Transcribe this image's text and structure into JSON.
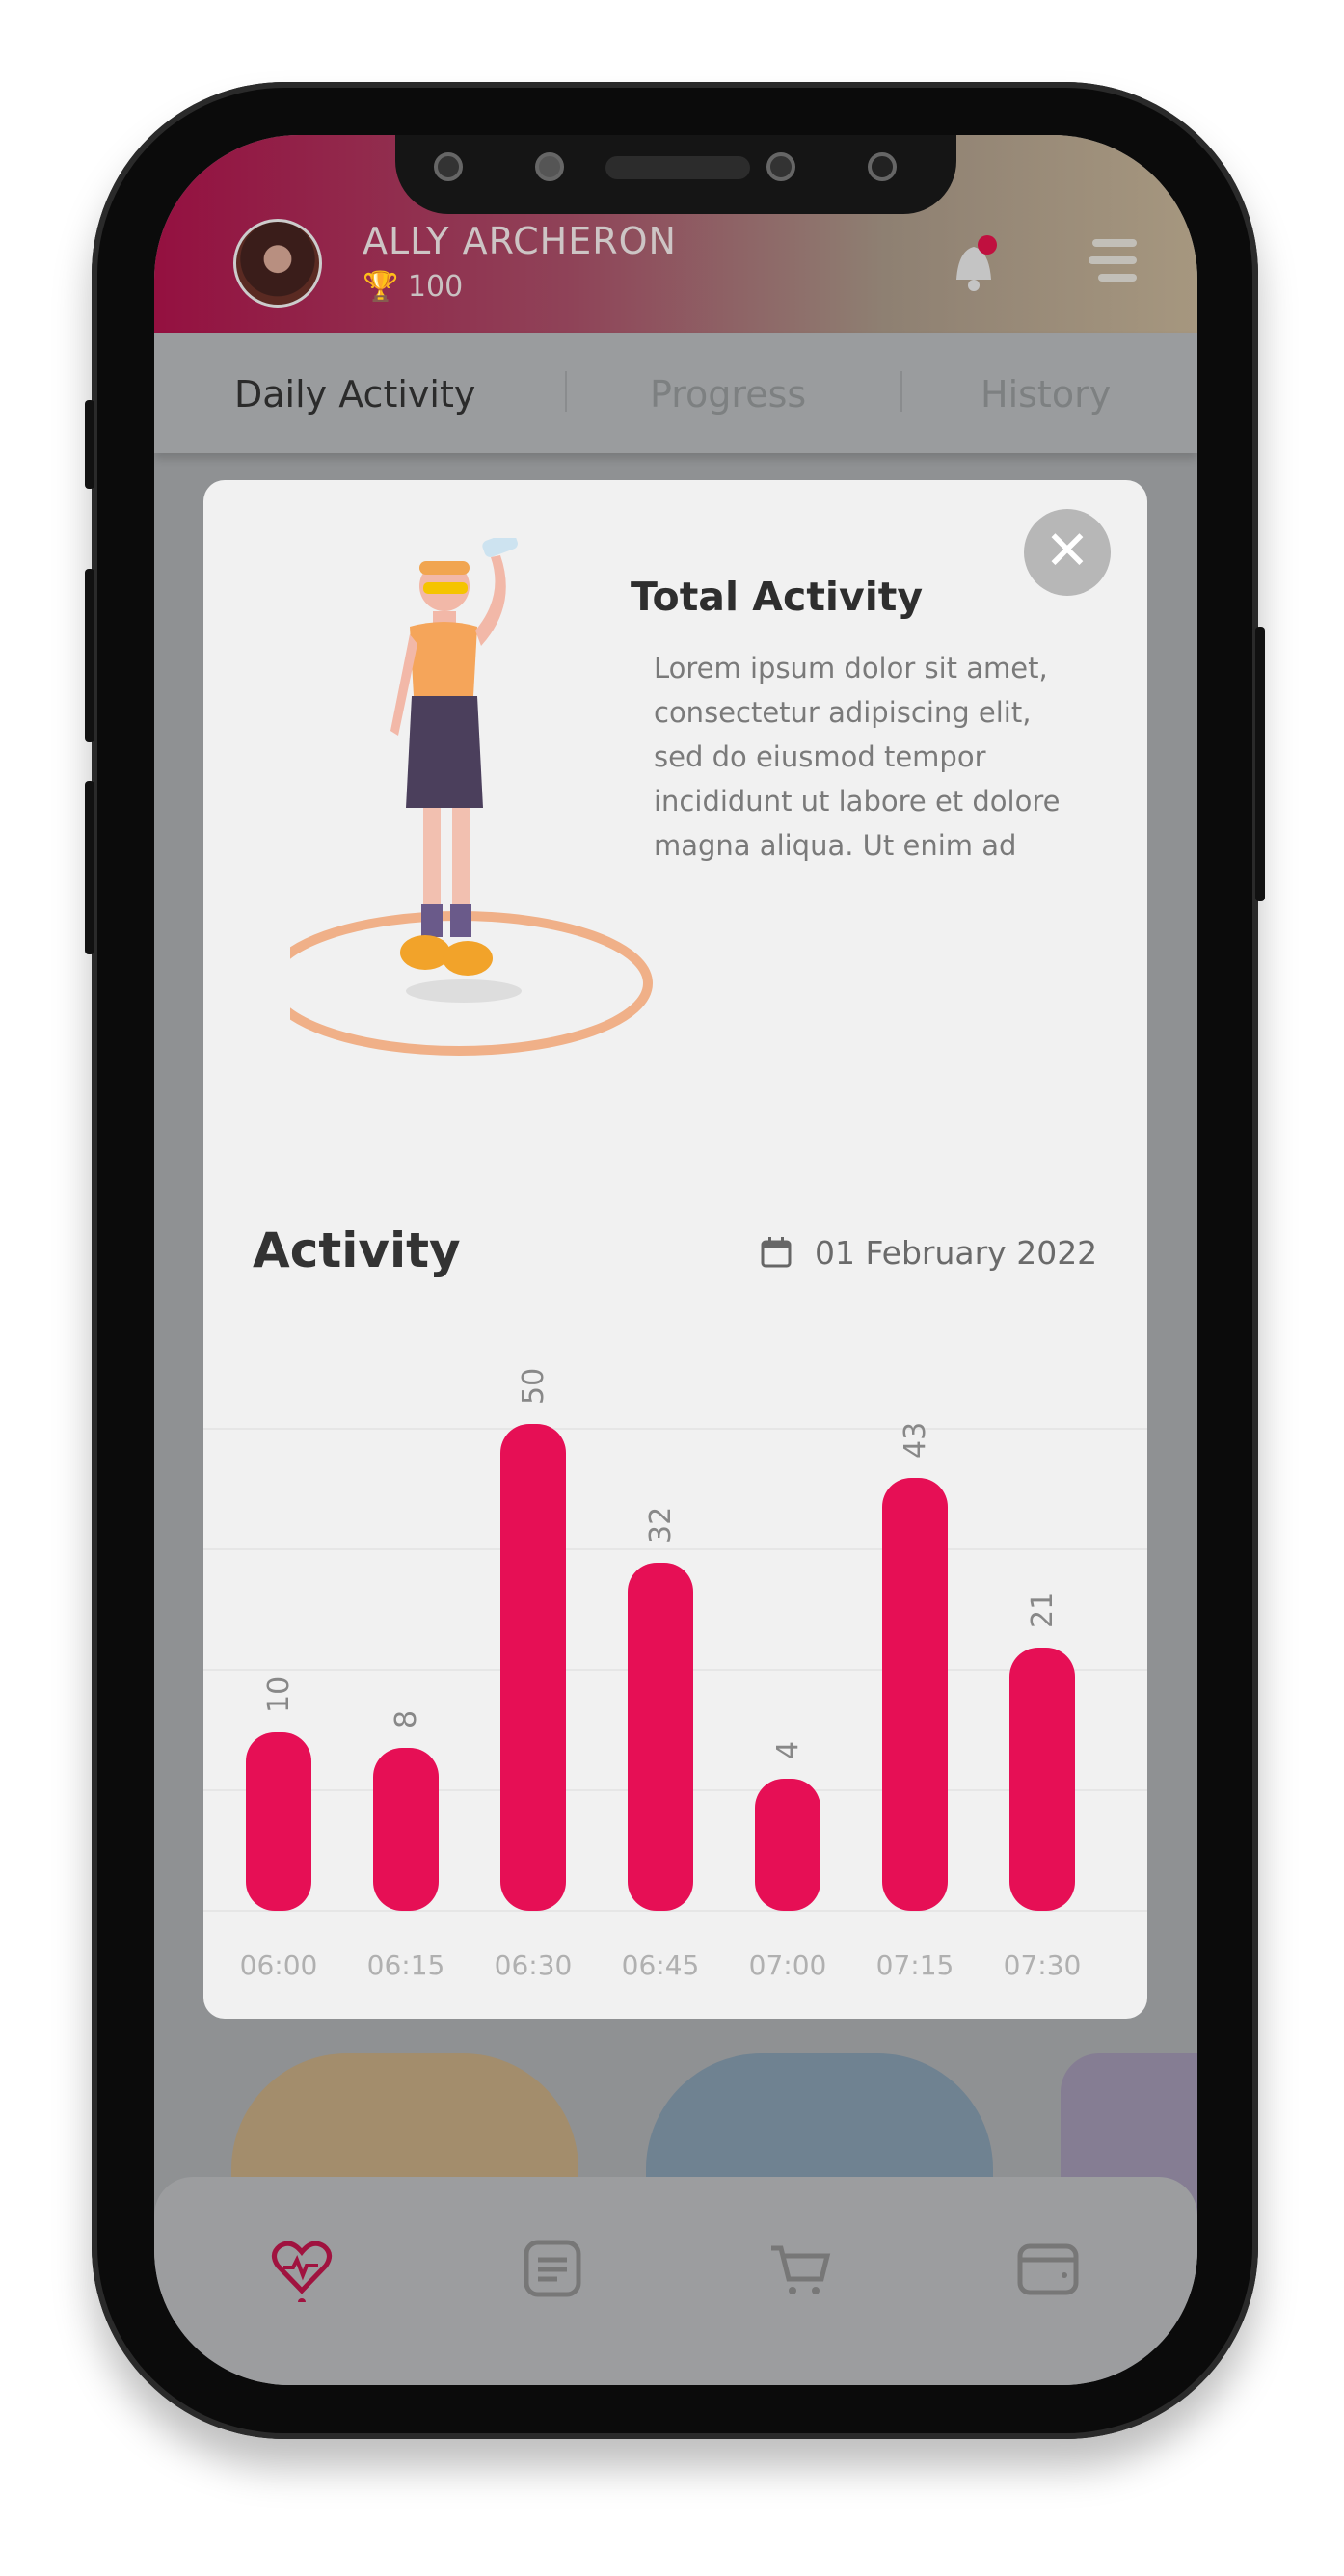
{
  "header": {
    "user_name": "ALLY ARCHERON",
    "points": "100",
    "notification_dot": true
  },
  "tabs": [
    {
      "label": "Daily Activity",
      "active": true
    },
    {
      "label": "Progress",
      "active": false
    },
    {
      "label": "History",
      "active": false
    }
  ],
  "modal": {
    "title": "Total Activity",
    "description_lines": [
      "Lorem ipsum dolor sit amet,",
      "consectetur adipiscing elit,",
      "sed do eiusmod tempor",
      "incididunt ut labore et dolore",
      "magna aliqua. Ut enim ad"
    ],
    "close_icon": "close-icon",
    "section_title": "Activity",
    "date": "01 February 2022"
  },
  "chart_data": {
    "type": "bar",
    "categories": [
      "06:00",
      "06:15",
      "06:30",
      "06:45",
      "07:00",
      "07:15",
      "07:30"
    ],
    "values": [
      10,
      8,
      50,
      32,
      4,
      43,
      21
    ],
    "title": "",
    "xlabel": "",
    "ylabel": "",
    "grid": true,
    "bar_color": "#e60f55"
  },
  "bottom_nav": [
    {
      "icon": "heart-pulse-icon",
      "active": true
    },
    {
      "icon": "list-icon",
      "active": false
    },
    {
      "icon": "cart-icon",
      "active": false
    },
    {
      "icon": "wallet-icon",
      "active": false
    }
  ],
  "colors": {
    "accent": "#e60f55",
    "active_nav": "#a0133f"
  }
}
